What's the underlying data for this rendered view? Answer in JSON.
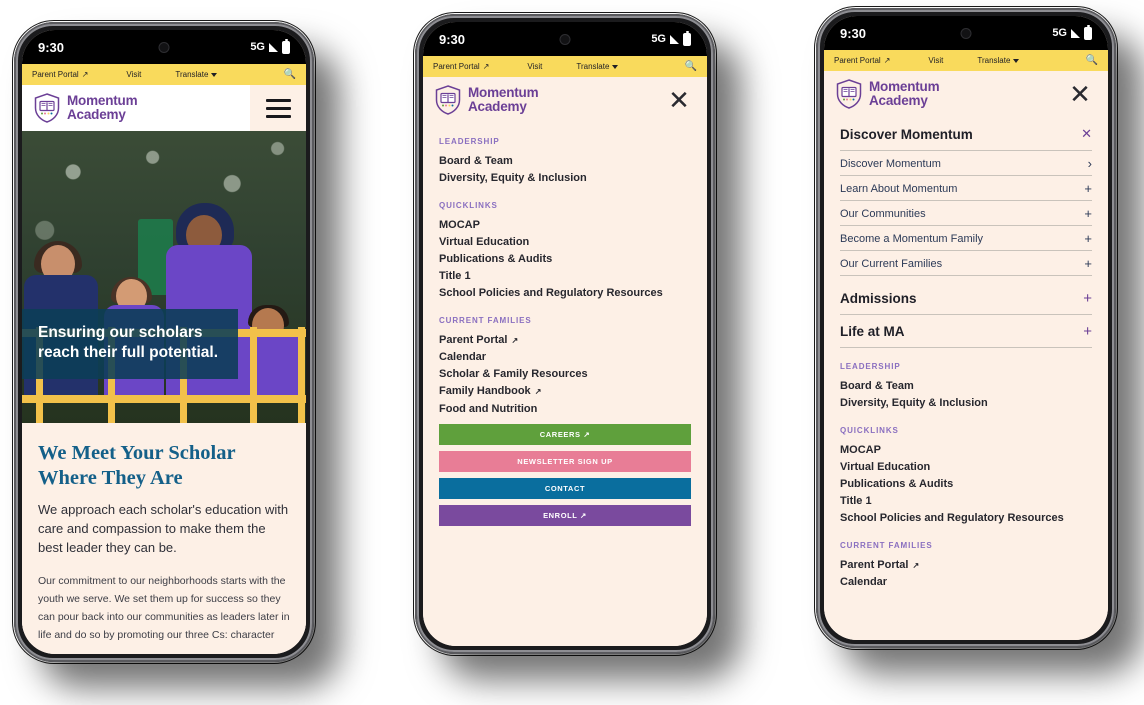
{
  "status_bar": {
    "time": "9:30",
    "network": "5G",
    "camera": "front-camera"
  },
  "utility_bar": {
    "parent_portal": "Parent Portal",
    "visit": "Visit",
    "translate": "Translate",
    "search_icon": "search-icon",
    "external_icon": "external-link-icon",
    "caret_icon": "chevron-down-icon"
  },
  "brand": {
    "line1": "Momentum",
    "line2": "Academy",
    "logo": "shield-book-logo"
  },
  "phone1": {
    "menu_icon": "hamburger-menu-icon",
    "hero": {
      "heading": "Ensuring our scholars reach their full potential.",
      "image_alt": "students-on-playground"
    },
    "section": {
      "heading": "We Meet Your Scholar Where They Are",
      "lead": "We approach each scholar's education with care and compassion to make them the best leader they can be.",
      "body": "Our commitment to our neighborhoods starts with the youth we serve. We set them up for success so they can pour back into our communities as leaders later in life and do so by promoting our three Cs: character"
    }
  },
  "phone2": {
    "close_icon": "close-icon",
    "groups": [
      {
        "label": "LEADERSHIP",
        "items": [
          {
            "text": "Board & Team",
            "external": false
          },
          {
            "text": "Diversity, Equity & Inclusion",
            "external": false
          }
        ]
      },
      {
        "label": "QUICKLINKS",
        "items": [
          {
            "text": "MOCAP",
            "external": false
          },
          {
            "text": "Virtual Education",
            "external": false
          },
          {
            "text": "Publications & Audits",
            "external": false
          },
          {
            "text": "Title 1",
            "external": false
          },
          {
            "text": "School Policies and Regulatory Resources",
            "external": false
          }
        ]
      },
      {
        "label": "CURRENT FAMILIES",
        "items": [
          {
            "text": "Parent Portal",
            "external": true
          },
          {
            "text": "Calendar",
            "external": false
          },
          {
            "text": "Scholar & Family Resources",
            "external": false
          },
          {
            "text": "Family Handbook",
            "external": true
          },
          {
            "text": "Food and Nutrition",
            "external": false
          }
        ]
      }
    ],
    "cta_buttons": [
      {
        "label": "CAREERS",
        "color": "#5FA03C",
        "external": true
      },
      {
        "label": "NEWSLETTER SIGN UP",
        "color": "#E87D96",
        "external": false
      },
      {
        "label": "CONTACT",
        "color": "#0A6E9E",
        "external": false
      },
      {
        "label": "ENROLL",
        "color": "#7A4A9E",
        "external": true
      }
    ]
  },
  "phone3": {
    "close_icon": "close-icon",
    "panel_title": "Discover Momentum",
    "panel_close_icon": "close-icon",
    "rows": [
      {
        "text": "Discover Momentum",
        "sign": "›",
        "major": false
      },
      {
        "text": "Learn About Momentum",
        "sign": "+",
        "major": false
      },
      {
        "text": "Our Communities",
        "sign": "+",
        "major": false
      },
      {
        "text": "Become a Momentum Family",
        "sign": "+",
        "major": false
      },
      {
        "text": "Our Current Families",
        "sign": "+",
        "major": false
      }
    ],
    "major_rows": [
      {
        "text": "Admissions",
        "sign": "+"
      },
      {
        "text": "Life at MA",
        "sign": "+"
      }
    ],
    "groups": [
      {
        "label": "LEADERSHIP",
        "items": [
          {
            "text": "Board & Team",
            "external": false
          },
          {
            "text": "Diversity, Equity & Inclusion",
            "external": false
          }
        ]
      },
      {
        "label": "QUICKLINKS",
        "items": [
          {
            "text": "MOCAP",
            "external": false
          },
          {
            "text": "Virtual Education",
            "external": false
          },
          {
            "text": "Publications & Audits",
            "external": false
          },
          {
            "text": "Title 1",
            "external": false
          },
          {
            "text": "School Policies and Regulatory Resources",
            "external": false
          }
        ]
      },
      {
        "label": "CURRENT FAMILIES",
        "items": [
          {
            "text": "Parent Portal",
            "external": true
          },
          {
            "text": "Calendar",
            "external": false
          }
        ]
      }
    ]
  },
  "colors": {
    "yellow": "#F9DA5C",
    "cream": "#FDF0E6",
    "purple": "#6B3F96",
    "teal": "#0B3E57",
    "heading_blue": "#146089"
  }
}
